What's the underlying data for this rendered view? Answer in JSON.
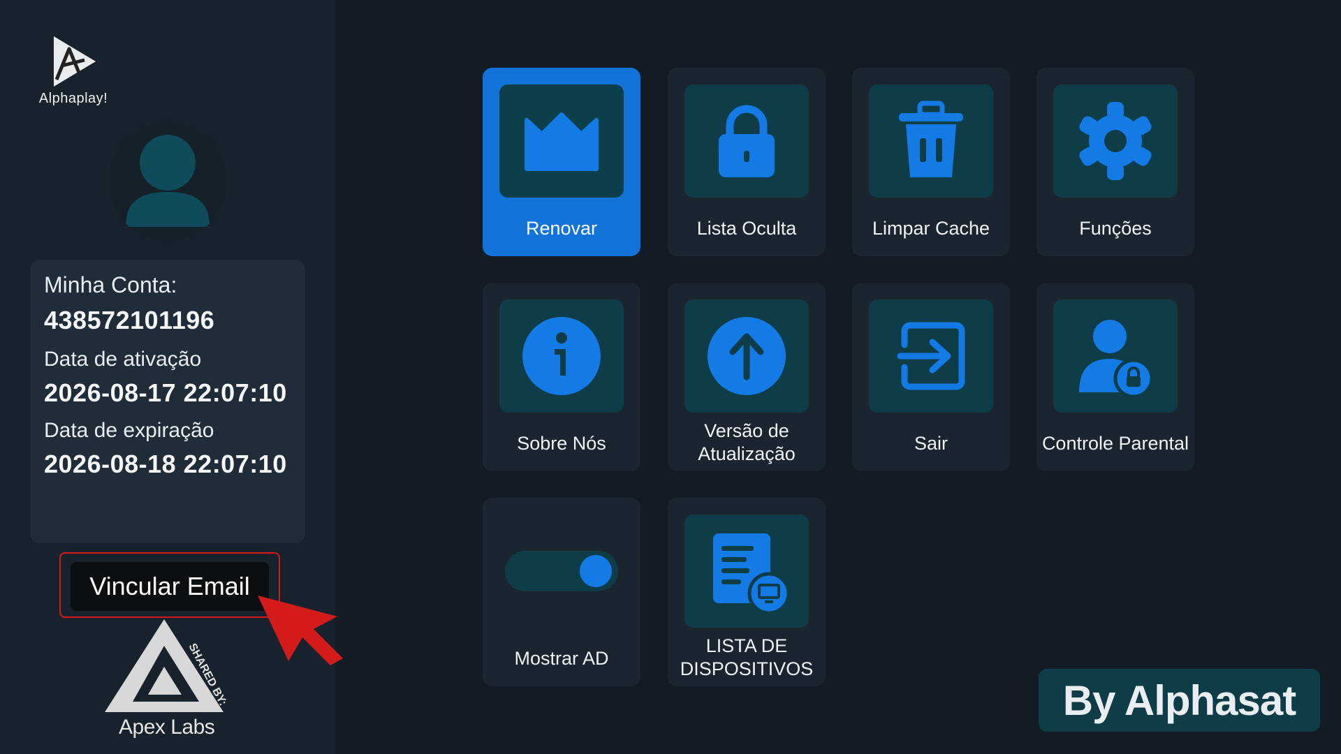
{
  "app": {
    "logo_text": "Alphaplay!"
  },
  "account": {
    "account_label": "Minha Conta:",
    "account_number": "438572101196",
    "activation_label": "Data de ativação",
    "activation_date": "2026-08-17 22:07:10",
    "expiration_label": "Data de expiração",
    "expiration_date": "2026-08-18 22:07:10"
  },
  "link_email": {
    "label": "Vincular Email"
  },
  "watermark": {
    "apex_text": "Apex Labs",
    "shared_by": "SHARED BY:"
  },
  "tiles": [
    {
      "label": "Renovar",
      "icon": "crown-icon"
    },
    {
      "label": "Lista Oculta",
      "icon": "lock-icon"
    },
    {
      "label": "Limpar Cache",
      "icon": "trash-icon"
    },
    {
      "label": "Funções",
      "icon": "gear-icon"
    },
    {
      "label": "Sobre Nós",
      "icon": "info-icon"
    },
    {
      "label": "Versão de Atualização",
      "icon": "upload-arrow-icon"
    },
    {
      "label": "Sair",
      "icon": "exit-icon"
    },
    {
      "label": "Controle Parental",
      "icon": "parental-user-lock-icon"
    },
    {
      "label": "Mostrar AD",
      "icon": "toggle-icon",
      "toggle_on": true
    },
    {
      "label": "LISTA DE DISPOSITIVOS",
      "icon": "device-list-icon"
    }
  ],
  "branding": {
    "by_text": "By Alphasat"
  },
  "colors": {
    "accent": "#1273d8",
    "icon_blue": "#137ae6",
    "icon_bg": "#0e3c47",
    "alert_red": "#d31b1b"
  }
}
